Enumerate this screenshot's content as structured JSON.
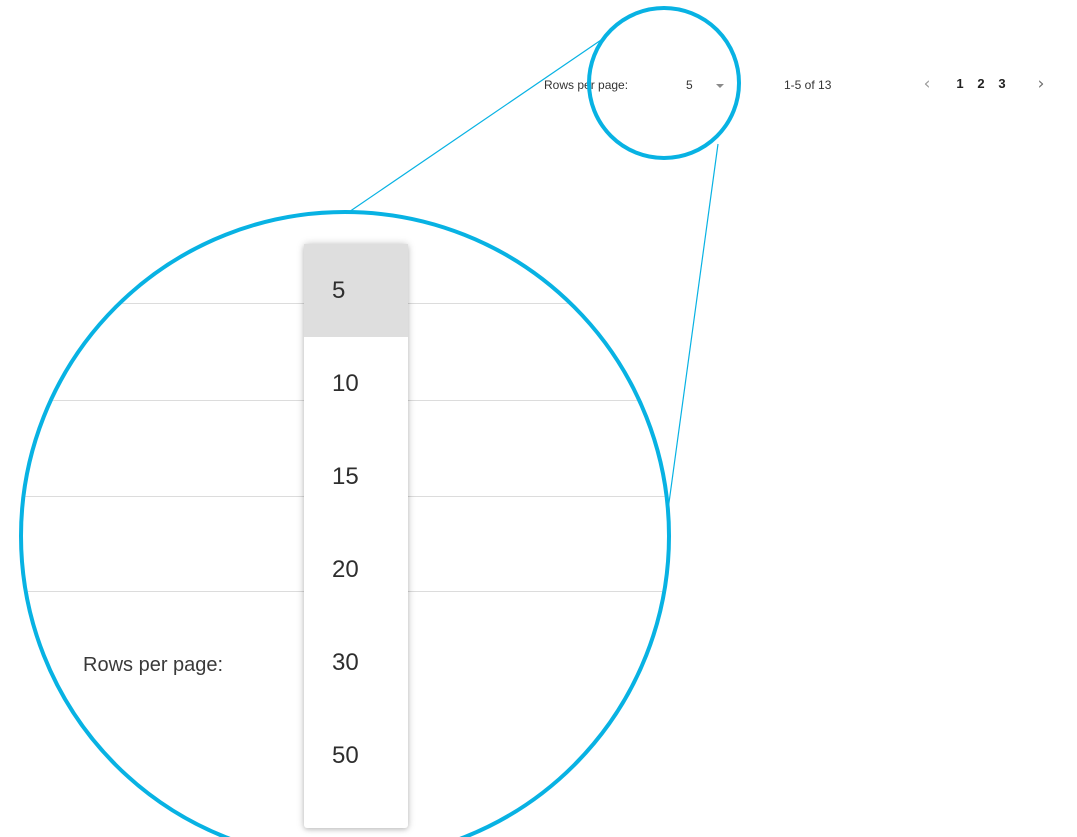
{
  "pagination": {
    "rows_per_page_label": "Rows per page:",
    "rows_per_page_value": "5",
    "range_text": "1-5 of 13",
    "prev_icon": "chevron-left-icon",
    "next_icon": "chevron-right-icon",
    "prev_glyph": "‹",
    "next_glyph": "›",
    "pages": [
      "1",
      "2",
      "3"
    ]
  },
  "zoom": {
    "rows_per_page_label": "Rows per page:",
    "options": [
      "5",
      "10",
      "15",
      "20",
      "30",
      "50"
    ],
    "selected_option": "5"
  },
  "colors": {
    "callout": "#08b2e3",
    "selected_bg": "#dedede"
  }
}
